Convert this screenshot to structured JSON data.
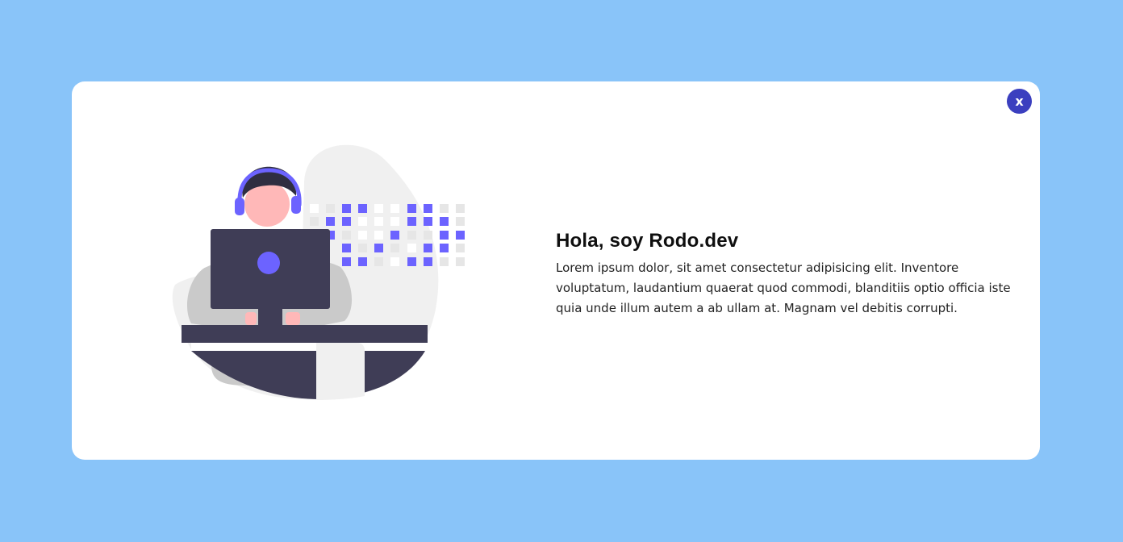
{
  "modal": {
    "close_label": "x",
    "title": "Hola, soy Rodo.dev",
    "paragraph": "Lorem ipsum dolor, sit amet consectetur adipisicing elit. Inventore voluptatum, laudantium quaerat quod commodi, blanditiis optio officia iste quia unde illum autem a ab ullam at. Magnam vel debitis corrupti."
  },
  "colors": {
    "page_background": "#89c4f9",
    "modal_background": "#ffffff",
    "close_button": "#3b3fbf",
    "accent_purple": "#6c63ff",
    "dark_slate": "#3f3d56"
  },
  "illustration": {
    "icon": "developer-at-computer-illustration"
  }
}
